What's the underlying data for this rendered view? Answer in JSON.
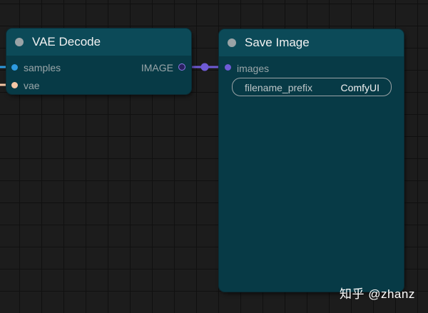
{
  "nodes": {
    "vae_decode": {
      "title": "VAE Decode",
      "inputs": [
        {
          "label": "samples",
          "color": "#2e9be0"
        },
        {
          "label": "vae",
          "color": "#f6c7a6"
        }
      ],
      "outputs": [
        {
          "label": "IMAGE",
          "color": "#6f5bd6"
        }
      ]
    },
    "save_image": {
      "title": "Save Image",
      "inputs": [
        {
          "label": "images",
          "color": "#6f5bd6"
        }
      ],
      "widgets": [
        {
          "name": "filename_prefix",
          "value": "ComfyUI"
        }
      ]
    }
  },
  "colors": {
    "canvas_bg": "#1c1c1c",
    "node_body": "#073a46",
    "node_header": "#0c4a58",
    "image_link": "#6f5bd6",
    "latent_link": "#2e9be0",
    "vae_link": "#f6c7a6"
  },
  "watermark": "知乎 @zhanz"
}
